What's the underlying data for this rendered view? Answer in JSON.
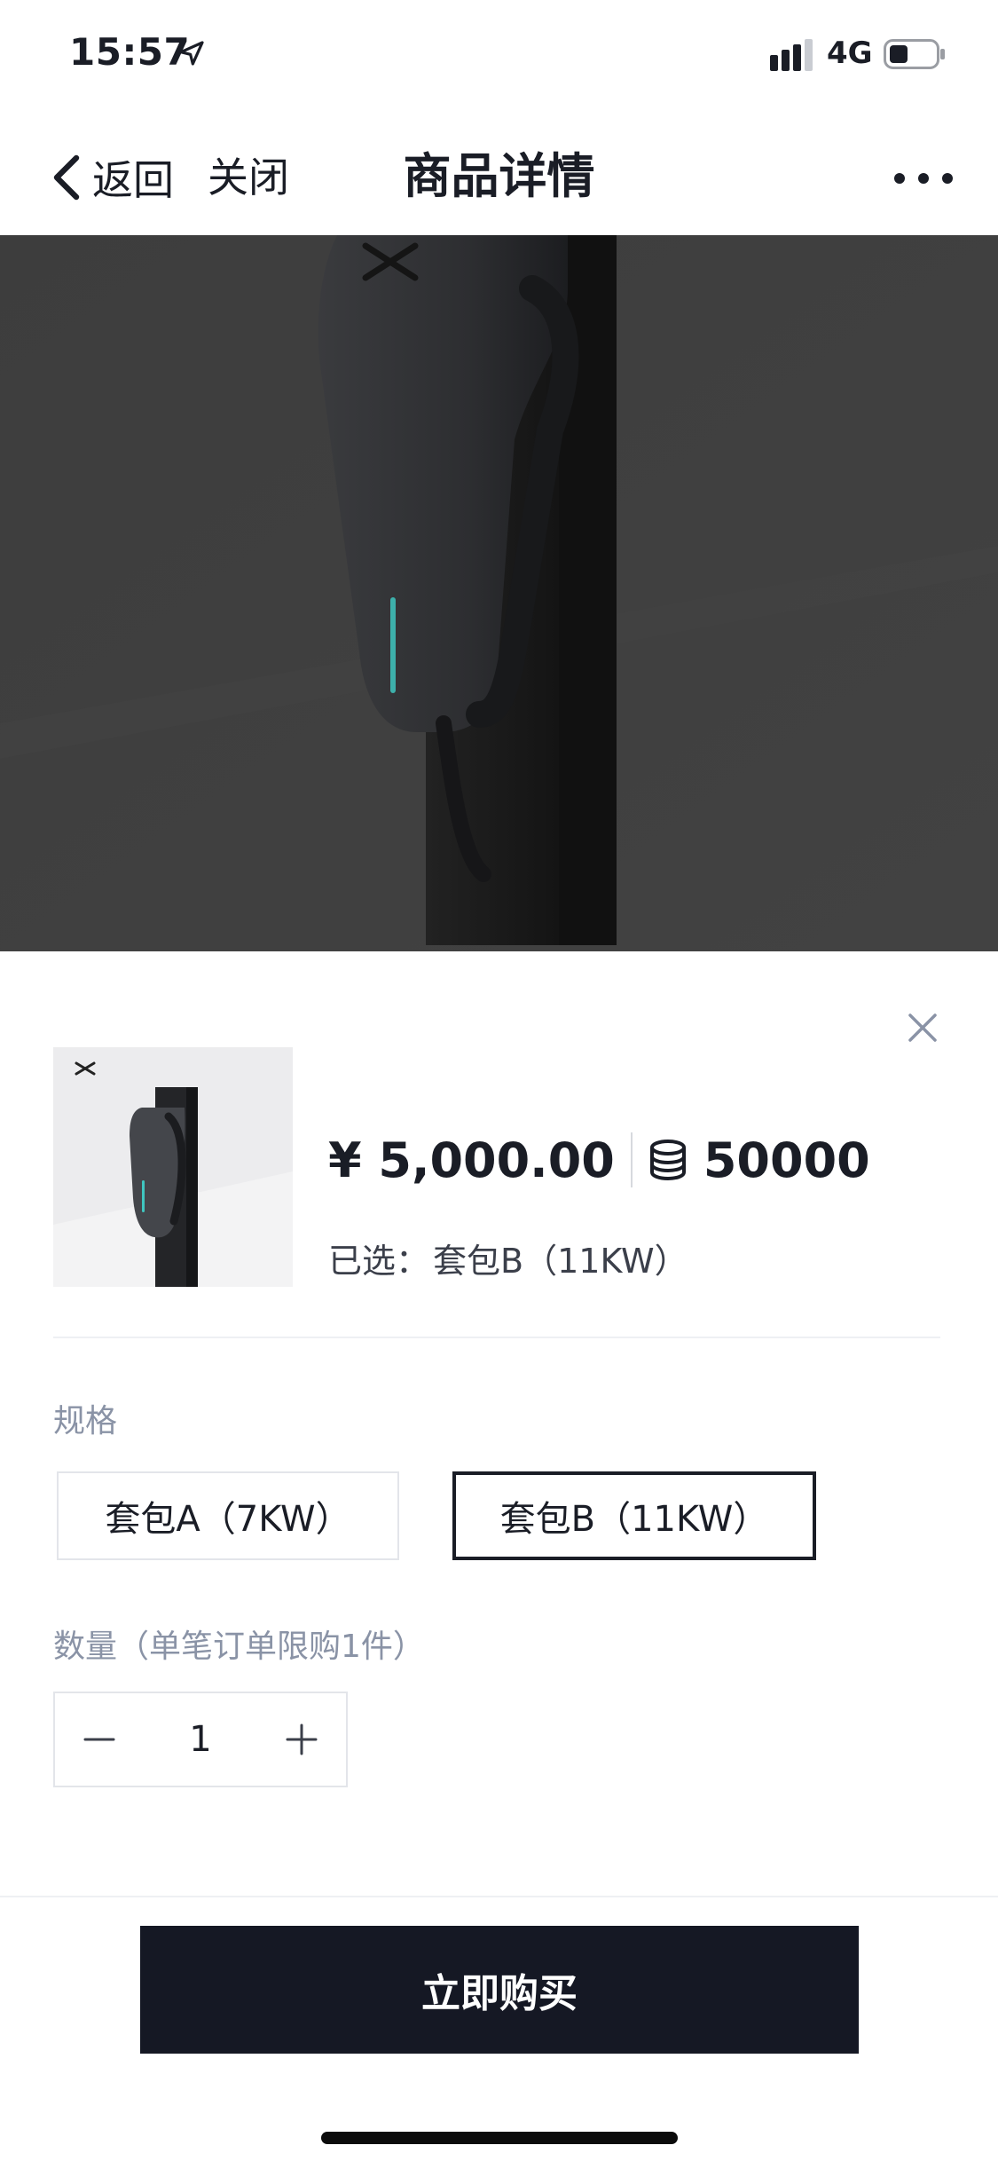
{
  "status_bar": {
    "time": "15:57",
    "network": "4G",
    "icons": [
      "location-arrow-icon",
      "signal-icon",
      "battery-icon"
    ]
  },
  "nav": {
    "back_label": "返回",
    "close_label": "关闭",
    "title": "商品详情",
    "more_icon": "more-dots-icon"
  },
  "sheet": {
    "close_icon": "close-x-icon",
    "price_cny": "¥ 5,000.00",
    "price_coin": "50000",
    "coin_icon": "coin-stack-icon",
    "selected_prefix": "已选：",
    "selected_value": "套包B（11KW）",
    "spec_label": "规格",
    "spec_options": [
      {
        "label": "套包A（7KW）",
        "selected": false
      },
      {
        "label": "套包B（11KW）",
        "selected": true
      }
    ],
    "qty_label": "数量（单笔订单限购1件）",
    "qty_value": "1",
    "buy_label": "立即购买"
  },
  "colors": {
    "accent_dark": "#151824",
    "muted_text": "#8a93a6",
    "charger_light": "#3fc6c0"
  }
}
